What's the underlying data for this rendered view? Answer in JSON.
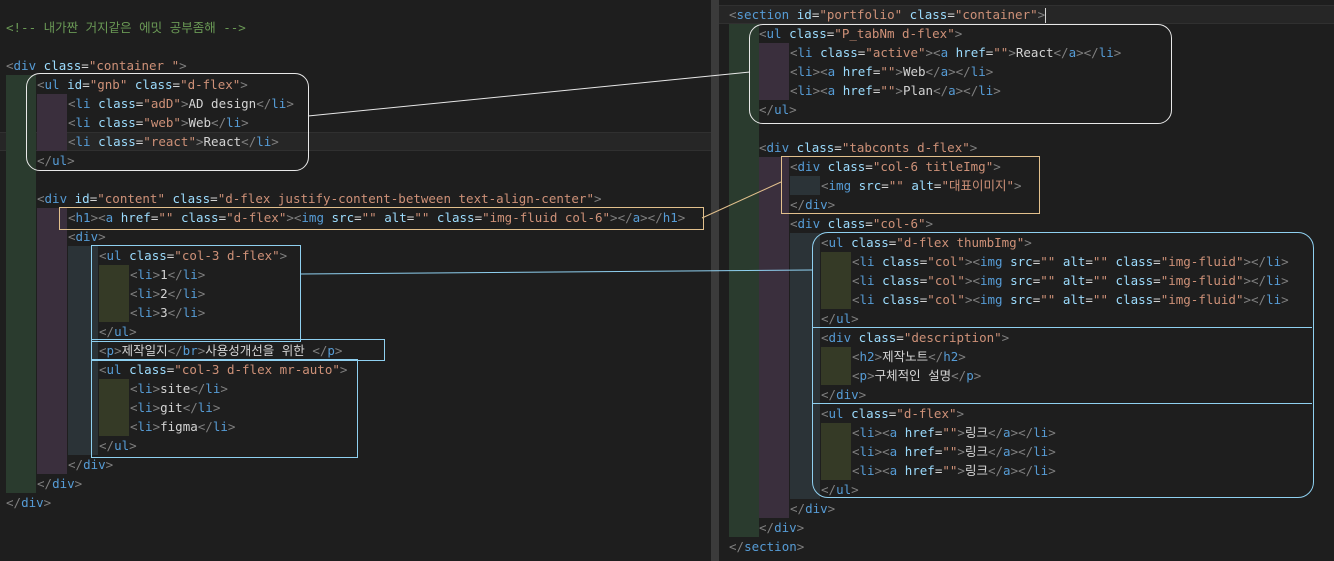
{
  "left_editor": {
    "comment": "<!-- 내가짠 거지같은 에밋 공부좀해 -->",
    "container_class": "container ",
    "gnb_id": "gnb",
    "gnb_class": "d-flex",
    "gnb_items": [
      {
        "cls": "adD",
        "text": "AD design"
      },
      {
        "cls": "web",
        "text": "Web"
      },
      {
        "cls": "react",
        "text": "React"
      }
    ],
    "content_id": "content",
    "content_class": "d-flex justify-content-between text-align-center",
    "h1_a_class": "d-flex",
    "h1_img_class": "img-fluid col-6",
    "list1_class": "col-3 d-flex",
    "list1_items": [
      "1",
      "2",
      "3"
    ],
    "p_text1": "제작일지",
    "p_text2": "사용성개선을 위한 ",
    "list2_class": "col-3 d-flex mr-auto",
    "list2_items": [
      "site",
      "git",
      "figma"
    ]
  },
  "right_editor": {
    "section_id": "portfolio",
    "section_class": "container",
    "tabnm_class": "P_tabNm d-flex",
    "active_class": "active",
    "tabs": [
      "React",
      "Web",
      "Plan"
    ],
    "tabconts_class": "tabconts d-flex",
    "titleimg_class": "col-6 titleImg",
    "img_alt": "대표이미지",
    "col6_class": "col-6",
    "thumb_class": "d-flex thumbImg",
    "thumb_li_class": "col",
    "thumb_img_class": "img-fluid",
    "desc_class": "description",
    "desc_h2": "제작노트",
    "desc_p": "구체적인 설명",
    "links_class": "d-flex",
    "links": [
      "링크",
      "링크",
      "링크"
    ]
  },
  "colors": {
    "background": "#1e1e1e",
    "tag": "#569cd6",
    "attribute": "#9cdcfe",
    "string": "#ce9178",
    "comment": "#6a9955",
    "text": "#d4d4d4",
    "annotation_white": "#e8e8e8",
    "annotation_yellow": "#e2c08d",
    "annotation_cyan": "#8fd0f0"
  }
}
